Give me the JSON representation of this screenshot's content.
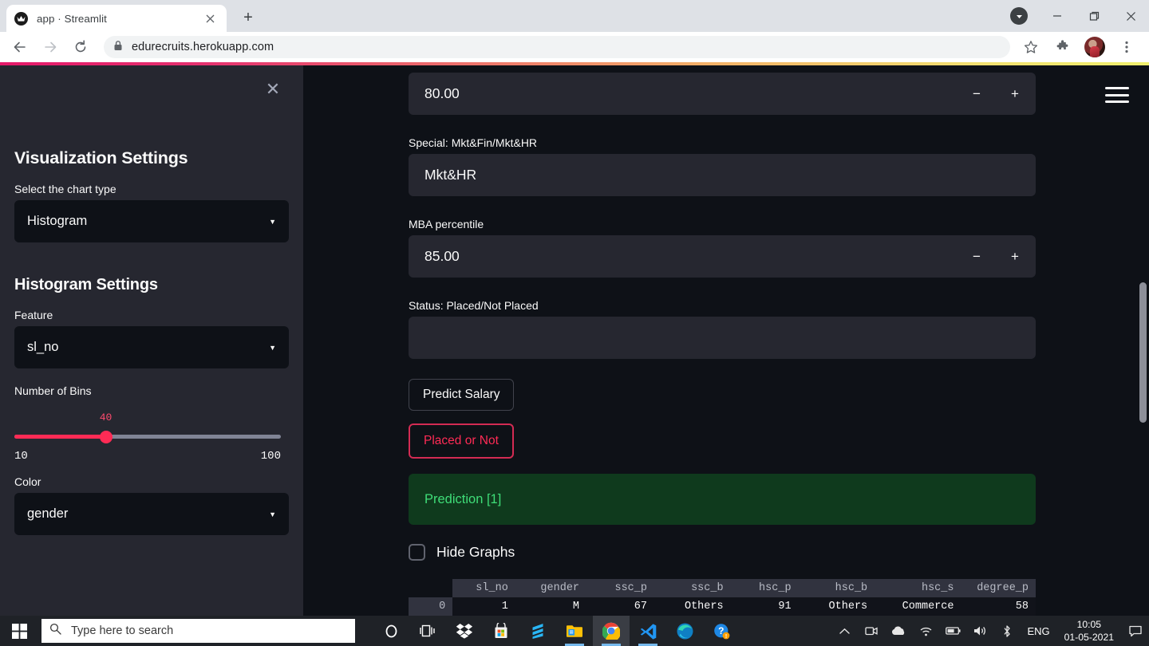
{
  "browser": {
    "tab": {
      "title": "app · Streamlit",
      "favicon": "streamlit-favicon",
      "close_label": "✕"
    },
    "new_tab_label": "+",
    "nav": {
      "back": "←",
      "forward": "→",
      "reload": "⟳"
    },
    "url": "edurecruits.herokuapp.com",
    "lock_icon": "lock-icon",
    "bookmark_icon": "star-icon",
    "extensions_icon": "puzzle-icon",
    "menu_icon": "kebab-menu-icon",
    "window": {
      "minimize": "—",
      "maximize": "❐",
      "close": "✕",
      "update": "▼"
    }
  },
  "sidebar": {
    "close_label": "✕",
    "viz_heading": "Visualization Settings",
    "chart_type_label": "Select the chart type",
    "chart_type_value": "Histogram",
    "hist_heading": "Histogram Settings",
    "feature_label": "Feature",
    "feature_value": "sl_no",
    "bins_label": "Number of Bins",
    "bins_value": "40",
    "bins_min": "10",
    "bins_max": "100",
    "bins_percent": 33.3,
    "color_label": "Color",
    "color_value": "gender"
  },
  "main": {
    "menu_icon": "hamburger-menu-icon",
    "degree_percentile_value": "80.00",
    "special_label": "Special: Mkt&Fin/Mkt&HR",
    "special_value": "Mkt&HR",
    "mba_label": "MBA percentile",
    "mba_value": "85.00",
    "status_label": "Status: Placed/Not Placed",
    "status_value": "",
    "predict_salary_label": "Predict Salary",
    "placed_or_not_label": "Placed or Not",
    "prediction_text": "Prediction [1]",
    "hide_graphs_label": "Hide Graphs",
    "stepper_minus": "−",
    "stepper_plus": "+",
    "accent_color": "#ff2b55",
    "success_color": "#3fdd78"
  },
  "table": {
    "index_header": "",
    "columns": [
      "sl_no",
      "gender",
      "ssc_p",
      "ssc_b",
      "hsc_p",
      "hsc_b",
      "hsc_s",
      "degree_p"
    ],
    "rows": [
      {
        "index": "0",
        "cells": [
          "1",
          "M",
          "67",
          "Others",
          "91",
          "Others",
          "Commerce",
          "58"
        ]
      }
    ]
  },
  "taskbar": {
    "start_icon": "windows-start-icon",
    "search_placeholder": "Type here to search",
    "search_icon": "search-icon",
    "icons": [
      {
        "name": "cortana-icon"
      },
      {
        "name": "task-view-icon"
      },
      {
        "name": "dropbox-icon"
      },
      {
        "name": "microsoft-store-icon"
      },
      {
        "name": "sublime-text-icon"
      },
      {
        "name": "file-explorer-icon"
      },
      {
        "name": "google-chrome-icon"
      },
      {
        "name": "visual-studio-code-icon"
      },
      {
        "name": "microsoft-edge-icon"
      },
      {
        "name": "help-icon"
      }
    ],
    "tray": [
      {
        "name": "show-hidden-icons-chevron"
      },
      {
        "name": "camera-icon"
      },
      {
        "name": "onedrive-icon"
      },
      {
        "name": "wifi-icon"
      },
      {
        "name": "battery-icon"
      },
      {
        "name": "volume-icon"
      },
      {
        "name": "bluetooth-icon"
      }
    ],
    "language": "ENG",
    "time": "10:05",
    "date": "01-05-2021",
    "action_center_icon": "action-center-icon"
  }
}
